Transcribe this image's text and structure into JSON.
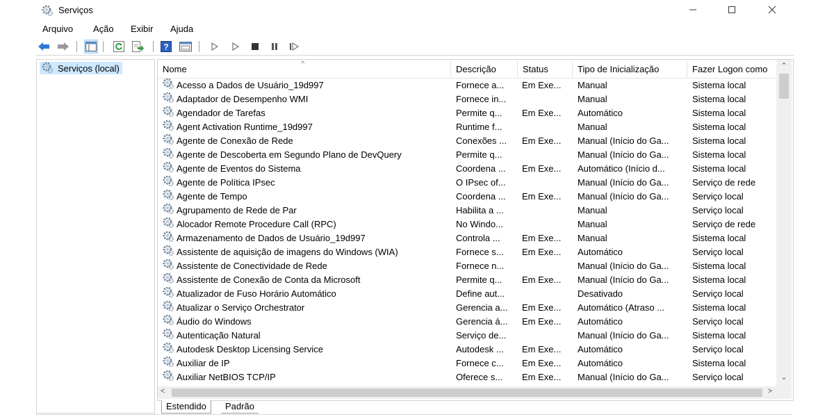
{
  "window": {
    "title": "Serviços",
    "controls": [
      "minimize",
      "maximize",
      "close"
    ]
  },
  "menu": {
    "items": [
      "Arquivo",
      "Ação",
      "Exibir",
      "Ajuda"
    ]
  },
  "toolbar": {
    "buttons": [
      "back-arrow-icon",
      "forward-arrow-icon",
      "show-hide-tree-icon",
      "refresh-icon",
      "export-list-icon",
      "help-icon",
      "properties-icon",
      "start-service-icon",
      "start-service-alt-icon",
      "stop-service-icon",
      "pause-service-icon",
      "resume-service-icon"
    ]
  },
  "tree": {
    "root_label": "Serviços (local)"
  },
  "columns": {
    "name": "Nome",
    "desc": "Descrição",
    "status": "Status",
    "startup": "Tipo de Inicialização",
    "logon": "Fazer Logon como"
  },
  "services": [
    {
      "name": "Acesso a Dados de Usuário_19d997",
      "desc": "Fornece a...",
      "status": "Em Exe...",
      "startup": "Manual",
      "logon": "Sistema local"
    },
    {
      "name": "Adaptador de Desempenho WMI",
      "desc": "Fornece in...",
      "status": "",
      "startup": "Manual",
      "logon": "Sistema local"
    },
    {
      "name": "Agendador de Tarefas",
      "desc": "Permite q...",
      "status": "Em Exe...",
      "startup": "Automático",
      "logon": "Sistema local"
    },
    {
      "name": "Agent Activation Runtime_19d997",
      "desc": "Runtime f...",
      "status": "",
      "startup": "Manual",
      "logon": "Sistema local"
    },
    {
      "name": "Agente de Conexão de Rede",
      "desc": "Conexões ...",
      "status": "Em Exe...",
      "startup": "Manual (Início do Ga...",
      "logon": "Sistema local"
    },
    {
      "name": "Agente de Descoberta em Segundo Plano de DevQuery",
      "desc": "Permite q...",
      "status": "",
      "startup": "Manual (Início do Ga...",
      "logon": "Sistema local"
    },
    {
      "name": "Agente de Eventos do Sistema",
      "desc": "Coordena ...",
      "status": "Em Exe...",
      "startup": "Automático (Início d...",
      "logon": "Sistema local"
    },
    {
      "name": "Agente de Política IPsec",
      "desc": "O IPsec of...",
      "status": "",
      "startup": "Manual (Início do Ga...",
      "logon": "Serviço de rede"
    },
    {
      "name": "Agente de Tempo",
      "desc": "Coordena ...",
      "status": "Em Exe...",
      "startup": "Manual (Início do Ga...",
      "logon": "Serviço local"
    },
    {
      "name": "Agrupamento de Rede de Par",
      "desc": "Habilita a ...",
      "status": "",
      "startup": "Manual",
      "logon": "Serviço local"
    },
    {
      "name": "Alocador Remote Procedure Call (RPC)",
      "desc": "No Windo...",
      "status": "",
      "startup": "Manual",
      "logon": "Serviço de rede"
    },
    {
      "name": "Armazenamento de Dados de Usuário_19d997",
      "desc": "Controla ...",
      "status": "Em Exe...",
      "startup": "Manual",
      "logon": "Sistema local"
    },
    {
      "name": "Assistente de aquisição de imagens do Windows (WIA)",
      "desc": "Fornece s...",
      "status": "Em Exe...",
      "startup": "Automático",
      "logon": "Serviço local"
    },
    {
      "name": "Assistente de Conectividade de Rede",
      "desc": "Fornece n...",
      "status": "",
      "startup": "Manual (Início do Ga...",
      "logon": "Sistema local"
    },
    {
      "name": "Assistente de Conexão de Conta da Microsoft",
      "desc": "Permite q...",
      "status": "Em Exe...",
      "startup": "Manual (Início do Ga...",
      "logon": "Sistema local"
    },
    {
      "name": "Atualizador de Fuso Horário Automático",
      "desc": "Define aut...",
      "status": "",
      "startup": "Desativado",
      "logon": "Serviço local"
    },
    {
      "name": "Atualizar o Serviço Orchestrator",
      "desc": "Gerencia a...",
      "status": "Em Exe...",
      "startup": "Automático (Atraso ...",
      "logon": "Sistema local"
    },
    {
      "name": "Áudio do Windows",
      "desc": "Gerencia á...",
      "status": "Em Exe...",
      "startup": "Automático",
      "logon": "Serviço local"
    },
    {
      "name": "Autenticação Natural",
      "desc": "Serviço de...",
      "status": "",
      "startup": "Manual (Início do Ga...",
      "logon": "Sistema local"
    },
    {
      "name": "Autodesk Desktop Licensing Service",
      "desc": "Autodesk ...",
      "status": "Em Exe...",
      "startup": "Automático",
      "logon": "Serviço local"
    },
    {
      "name": "Auxiliar de IP",
      "desc": "Fornece c...",
      "status": "Em Exe...",
      "startup": "Automático",
      "logon": "Sistema local"
    },
    {
      "name": "Auxiliar NetBIOS TCP/IP",
      "desc": "Oferece s...",
      "status": "Em Exe...",
      "startup": "Manual (Início do Ga...",
      "logon": "Serviço local"
    }
  ],
  "tabs": {
    "extended": "Estendido",
    "standard": "Padrão"
  },
  "scroll": {
    "sort_indicator": "^"
  }
}
